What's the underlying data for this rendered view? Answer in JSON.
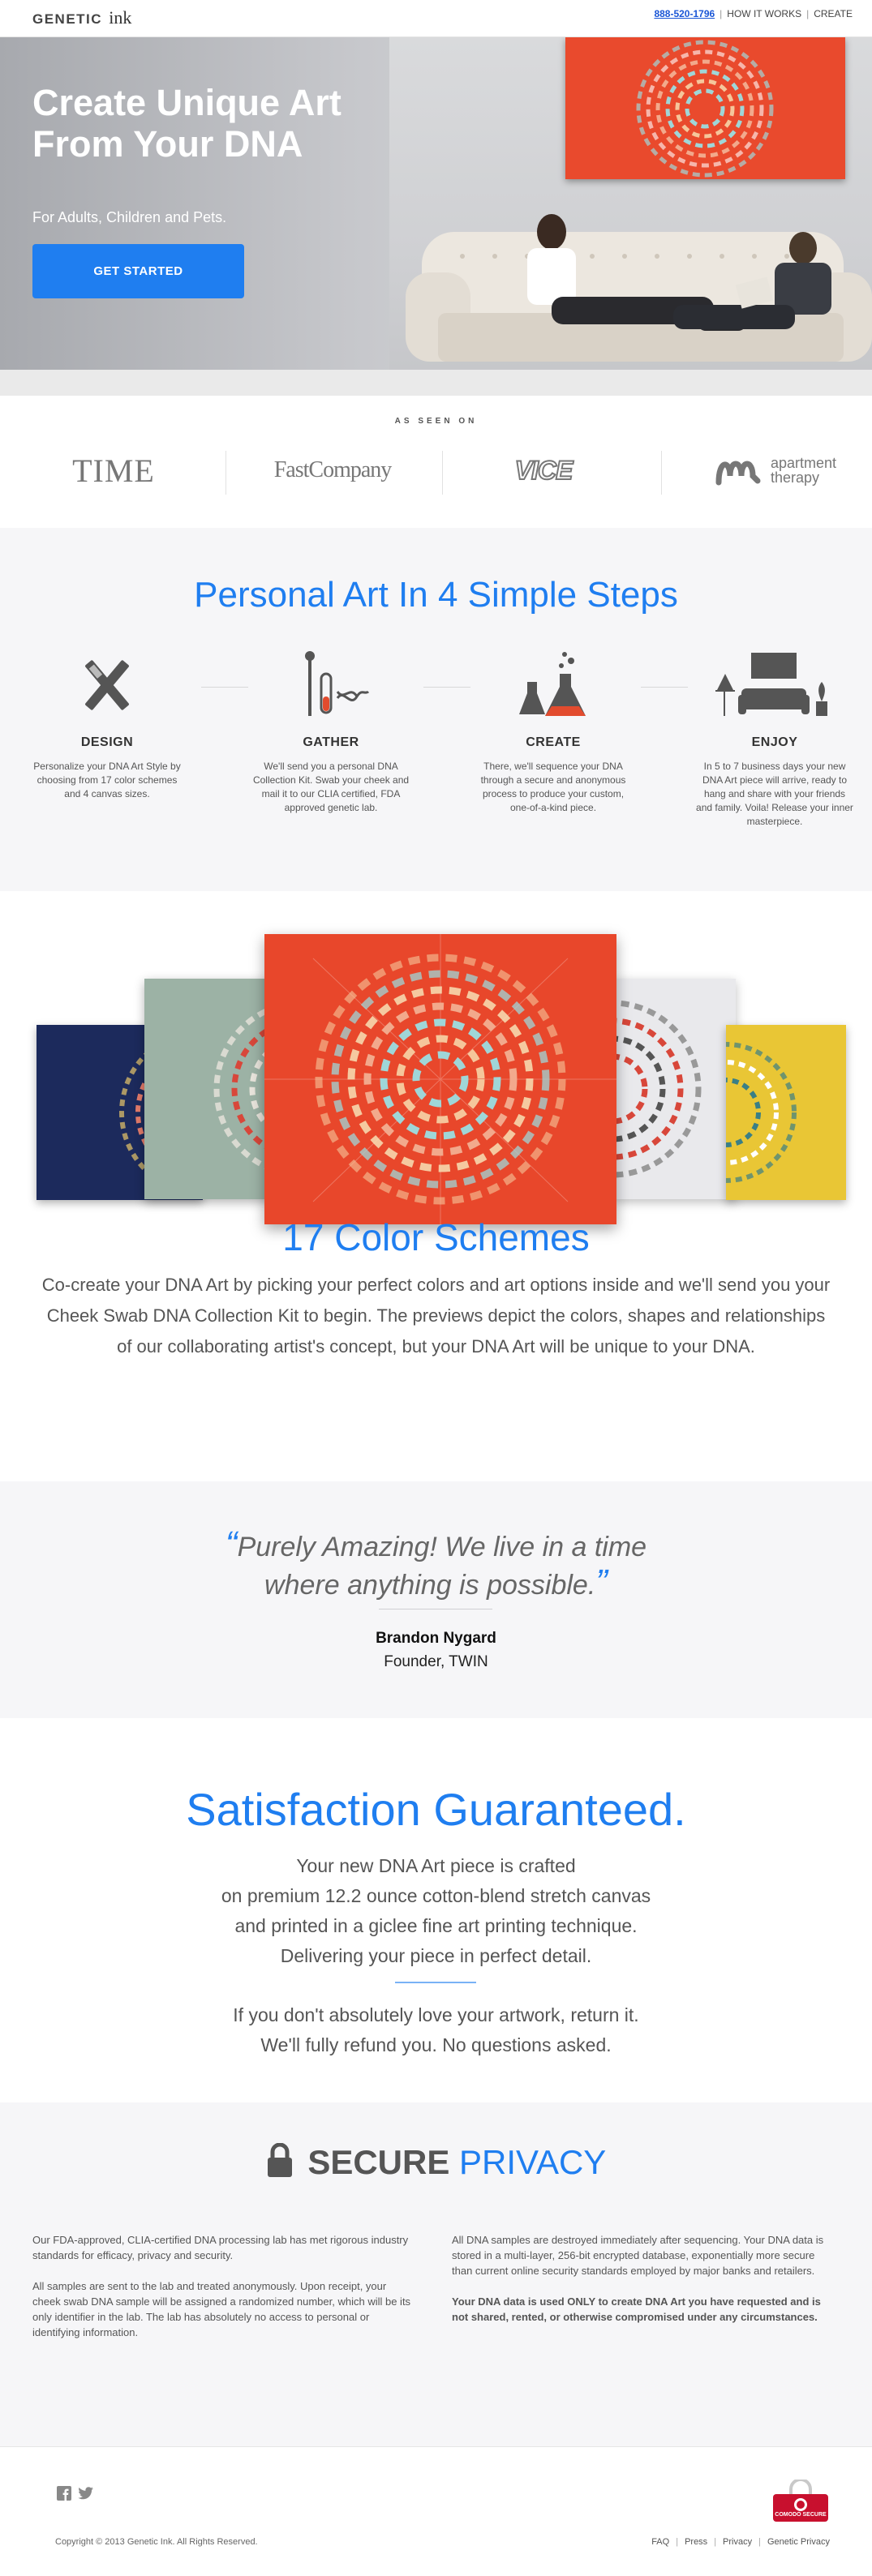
{
  "header": {
    "logo_text": "GENETIC",
    "logo_ink": "ink",
    "phone": "888-520-1796",
    "nav": [
      "HOW IT WORKS",
      "CREATE"
    ],
    "separator": "|"
  },
  "hero": {
    "title": "Create Unique Art From Your DNA",
    "subtitle": "For Adults, Children and Pets.",
    "cta_label": "GET STARTED",
    "accent_color": "#1f7ef0"
  },
  "press": {
    "label": "AS SEEN ON",
    "logos": [
      "TIME",
      "FastCompany",
      "VICE",
      "apartment therapy"
    ]
  },
  "steps": {
    "title": "Personal Art In 4 Simple Steps",
    "items": [
      {
        "title": "DESIGN",
        "icon": "tools-icon",
        "text": "Personalize your DNA Art Style by choosing from 17 color schemes and 4 canvas sizes."
      },
      {
        "title": "GATHER",
        "icon": "swab-dna-icon",
        "text": "We'll send you a personal DNA Collection Kit. Swab your cheek and mail it to our CLIA certified, FDA approved genetic lab."
      },
      {
        "title": "CREATE",
        "icon": "flask-icon",
        "text": "There, we'll sequence your DNA through a secure and anonymous process to produce your custom, one-of-a-kind piece."
      },
      {
        "title": "ENJOY",
        "icon": "living-room-icon",
        "text": "In 5 to 7 business days your new DNA Art piece will arrive, ready to hang and share with your friends and family. Voila! Release your inner masterpiece."
      }
    ]
  },
  "schemes": {
    "title": "17 Color Schemes",
    "text": "Co-create your DNA Art by picking your perfect colors and art options inside and we'll send you your Cheek Swab DNA Collection Kit to begin. The previews depict the colors, shapes and relationships of our collaborating artist's concept, but your DNA Art will be unique to your DNA.",
    "canvas_colors": [
      "#1c2a5c",
      "#9cb2a5",
      "#e8472b",
      "#e9e9ec",
      "#e9c635"
    ]
  },
  "testimonial": {
    "open_quote": "“",
    "quote_line1": "Purely Amazing! We live in a time",
    "quote_line2": "where anything is possible.",
    "close_quote": "”",
    "name": "Brandon Nygard",
    "role": "Founder, TWIN"
  },
  "satisfaction": {
    "title": "Satisfaction Guaranteed.",
    "lines": [
      "Your new DNA Art piece is crafted",
      "on premium 12.2 ounce cotton-blend stretch canvas",
      "and printed in a giclee fine art printing technique.",
      "Delivering your piece in perfect detail."
    ],
    "refund_lines": [
      "If you don't absolutely love your artwork, return it.",
      "We'll fully refund you. No questions asked."
    ]
  },
  "secure": {
    "title_strong": "SECURE",
    "title_light": "PRIVACY",
    "left": [
      "Our FDA-approved, CLIA-certified DNA processing lab has met rigorous industry standards for efficacy, privacy and security.",
      "All samples are sent to the lab and treated anonymously. Upon receipt, your cheek swab DNA sample will be assigned a randomized number, which will be its only identifier in the lab. The lab has absolutely no access to personal or identifying information."
    ],
    "right": [
      "All DNA samples are destroyed immediately after sequencing. Your DNA data is stored in a multi-layer, 256-bit encrypted database, exponentially more secure than current online security standards employed by major banks and retailers."
    ],
    "right_bold": "Your DNA data is used ONLY to create DNA Art you have requested and is not shared, rented, or otherwise compromised under any circumstances."
  },
  "footer": {
    "copyright": "Copyright © 2013 Genetic Ink. All Rights Reserved.",
    "links": [
      "FAQ",
      "Press",
      "Privacy",
      "Genetic Privacy"
    ],
    "badge_text": "COMODO SECURE"
  }
}
